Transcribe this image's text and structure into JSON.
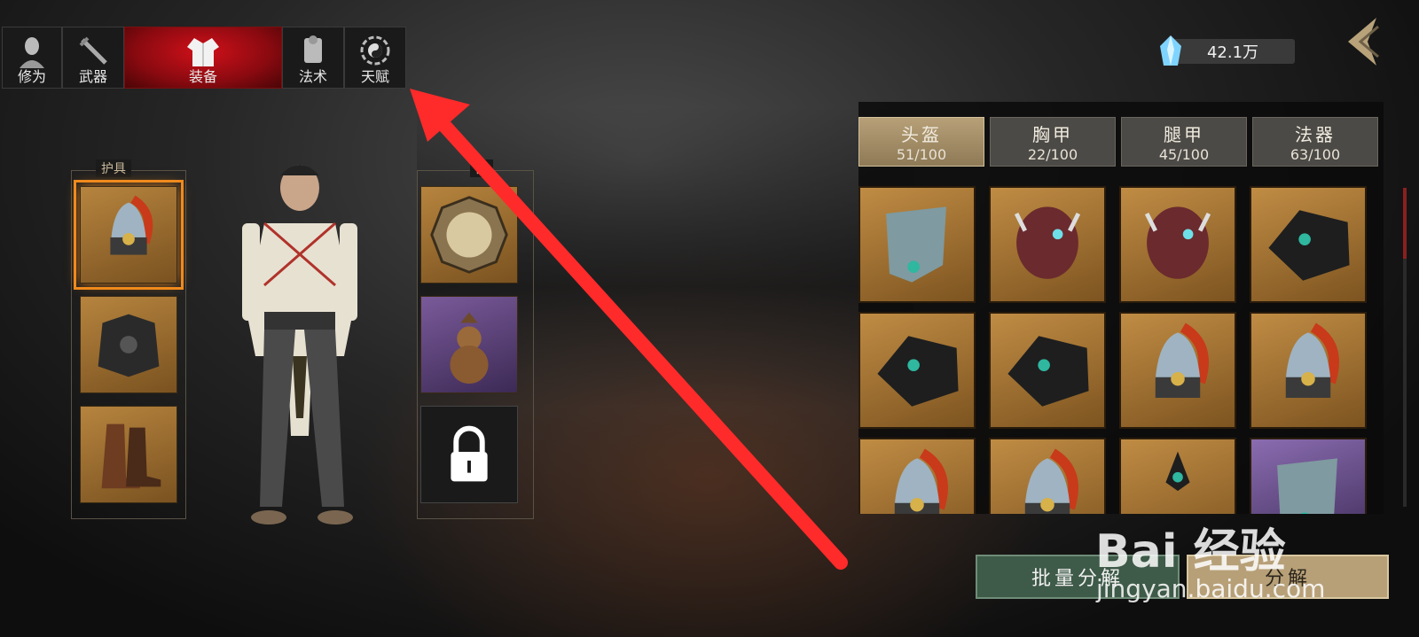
{
  "top_tabs": [
    {
      "label": "修为",
      "icon": "monk-head-icon",
      "active": false
    },
    {
      "label": "武器",
      "icon": "sword-icon",
      "active": false
    },
    {
      "label": "装备",
      "icon": "robe-icon",
      "active": true
    },
    {
      "label": "法术",
      "icon": "scroll-icon",
      "active": false
    },
    {
      "label": "天赋",
      "icon": "bagua-icon",
      "active": false
    }
  ],
  "currency": {
    "value": "42.1万",
    "icon": "crystal-gem-icon"
  },
  "armor_section": {
    "title": "护具",
    "slots": [
      {
        "item": "helmet-icon",
        "selected": true
      },
      {
        "item": "chest-armor-icon"
      },
      {
        "item": "boots-icon"
      }
    ]
  },
  "treasure_section": {
    "title": "器",
    "slots": [
      {
        "item": "bagua-mirror-icon"
      },
      {
        "item": "gourd-icon",
        "rarity": "purple"
      },
      {
        "item": "lock-icon",
        "locked": true
      }
    ]
  },
  "category_tabs": [
    {
      "name": "头盔",
      "count": "51/100",
      "active": true
    },
    {
      "name": "胸甲",
      "count": "22/100",
      "active": false
    },
    {
      "name": "腿甲",
      "count": "45/100",
      "active": false
    },
    {
      "name": "法器",
      "count": "63/100",
      "active": false
    }
  ],
  "inventory": [
    {
      "item": "shoulder-guard-icon",
      "rarity": "gold"
    },
    {
      "item": "demon-helmet-icon",
      "rarity": "gold"
    },
    {
      "item": "demon-helmet-icon",
      "rarity": "gold"
    },
    {
      "item": "hood-helmet-icon",
      "rarity": "gold"
    },
    {
      "item": "hood-helmet-icon",
      "rarity": "gold"
    },
    {
      "item": "hood-helmet-icon",
      "rarity": "gold"
    },
    {
      "item": "plumed-helmet-icon",
      "rarity": "gold"
    },
    {
      "item": "plumed-helmet-icon",
      "rarity": "gold"
    },
    {
      "item": "plumed-helmet-icon",
      "rarity": "gold"
    },
    {
      "item": "plumed-helmet-icon",
      "rarity": "gold"
    },
    {
      "item": "spike-helmet-icon",
      "rarity": "gold"
    },
    {
      "item": "shoulder-guard-icon",
      "rarity": "purple"
    }
  ],
  "buttons": {
    "batch_decompose": "批量分解",
    "decompose": "分解"
  },
  "watermark": {
    "brand": "Bai 经验",
    "url": "jingyan.baidu.com"
  },
  "colors": {
    "active_tab": "#d1101a",
    "gold_slot": "#b6843e",
    "purple_slot": "#7a5a9a",
    "selected_outline": "#f08a1c",
    "annotation_arrow": "#ff2a2a"
  }
}
